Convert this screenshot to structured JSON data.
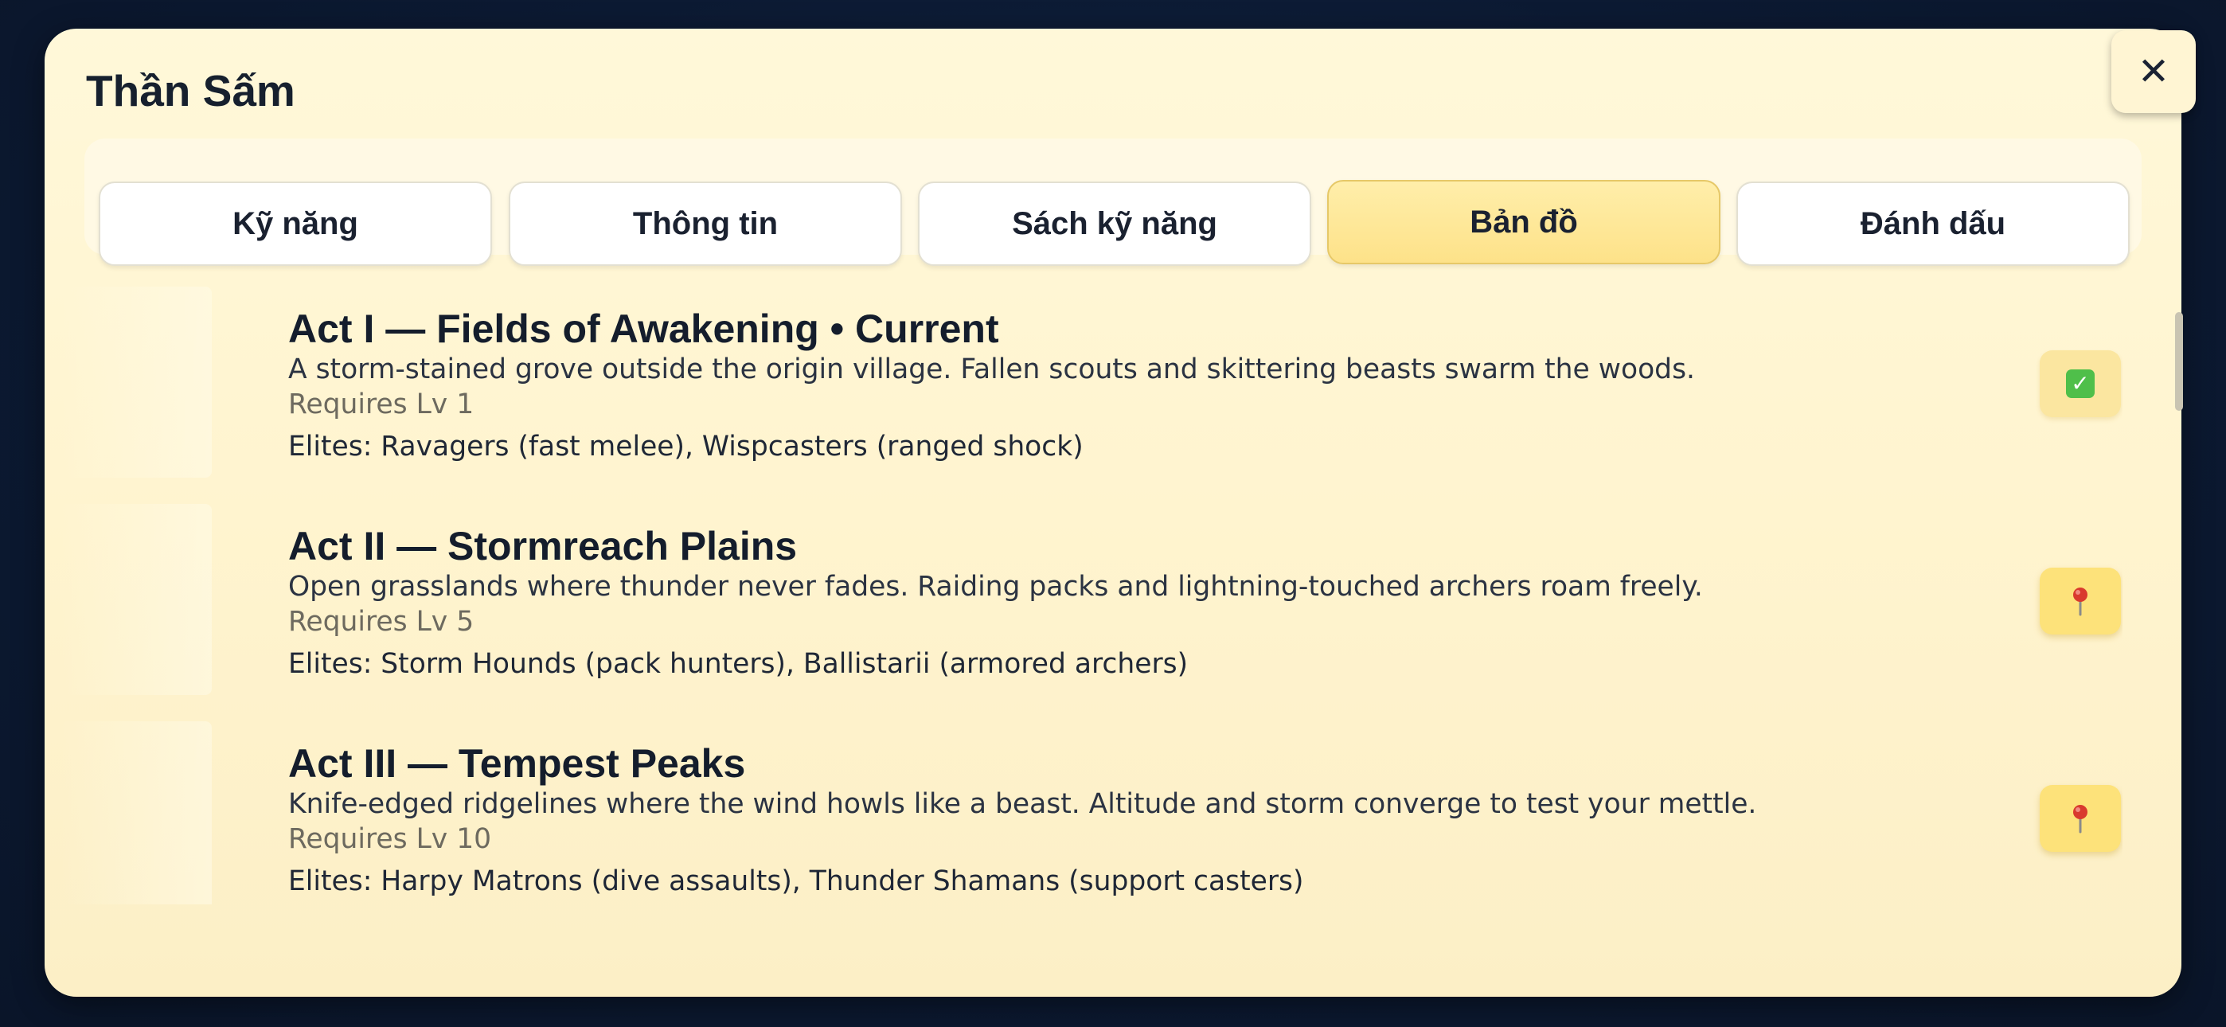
{
  "window": {
    "title": "Thần Sấm",
    "close_label": "✕"
  },
  "tabs": [
    {
      "label": "Kỹ năng",
      "active": false
    },
    {
      "label": "Thông tin",
      "active": false
    },
    {
      "label": "Sách kỹ năng",
      "active": false
    },
    {
      "label": "Bản đồ",
      "active": true
    },
    {
      "label": "Đánh dấu",
      "active": false
    }
  ],
  "acts": [
    {
      "title": "Act I — Fields of Awakening • Current",
      "description": "A storm-stained grove outside the origin village. Fallen scouts and skittering beasts swarm the woods.",
      "requirement": "Requires Lv 1",
      "elites": "Elites: Ravagers (fast melee), Wispcasters (ranged shock)",
      "button_icon": "check-mark-icon",
      "status": "current"
    },
    {
      "title": "Act II — Stormreach Plains",
      "description": "Open grasslands where thunder never fades. Raiding packs and lightning-touched archers roam freely.",
      "requirement": "Requires Lv 5",
      "elites": "Elites: Storm Hounds (pack hunters), Ballistarii (armored archers)",
      "button_icon": "map-pin-icon",
      "status": "travel"
    },
    {
      "title": "Act III — Tempest Peaks",
      "description": "Knife-edged ridgelines where the wind howls like a beast. Altitude and storm converge to test your mettle.",
      "requirement": "Requires Lv 10",
      "elites": "Elites: Harpy Matrons (dive assaults), Thunder Shamans (support casters)",
      "button_icon": "map-pin-icon",
      "status": "travel"
    }
  ],
  "colors": {
    "panel_bg": "#fff6d4",
    "active_tab": "#fde68f",
    "pin_button": "#fde27a",
    "check_green": "#4fbf4a",
    "pin_red": "#d93a2e",
    "page_bg": "#0c1a33"
  }
}
